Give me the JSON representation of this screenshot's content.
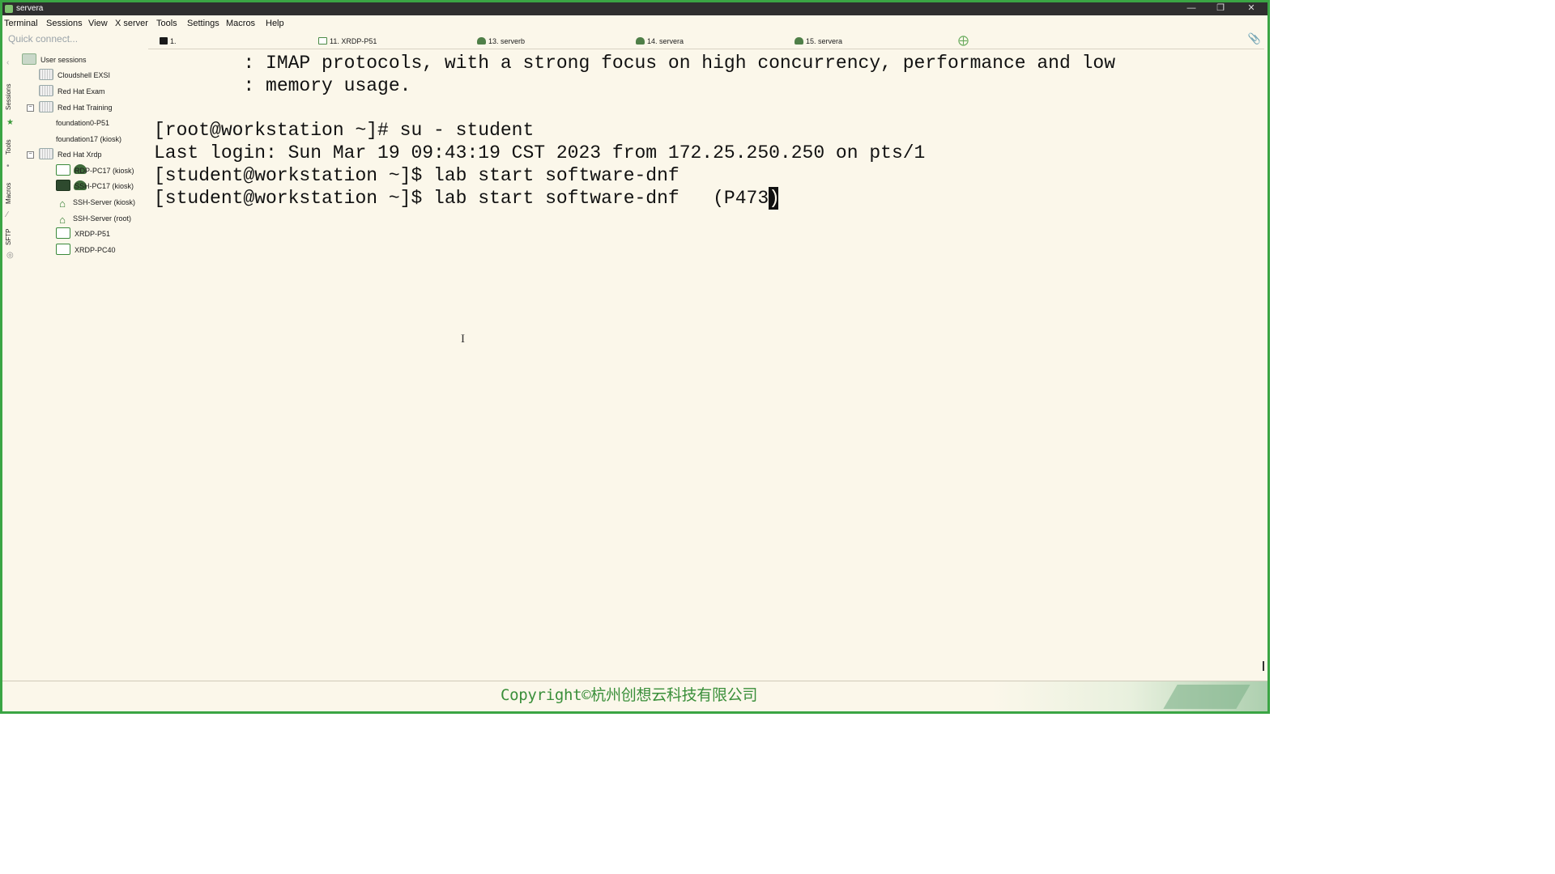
{
  "window": {
    "title": "servera"
  },
  "menu": [
    "Terminal",
    "Sessions",
    "View",
    "X server",
    "Tools",
    "Settings",
    "Macros",
    "Help"
  ],
  "quick_connect": {
    "placeholder": "Quick connect..."
  },
  "tabs": [
    {
      "label": "1.",
      "icon": "terminal-icon"
    },
    {
      "label": "11. XRDP-P51",
      "icon": "screen-icon"
    },
    {
      "label": "13. serverb",
      "icon": "tree-icon"
    },
    {
      "label": "14. servera",
      "icon": "tree-icon"
    },
    {
      "label": "15. servera",
      "icon": "tree-icon"
    }
  ],
  "side_tabs": [
    "Sessions",
    "Tools",
    "Macros",
    "SFTP"
  ],
  "tree": {
    "root": "User sessions",
    "items": [
      "Cloudshell EXSI",
      "Red Hat Exam",
      "Red Hat Training",
      "foundation0-P51",
      "foundation17 (kiosk)",
      "Red Hat Xrdp",
      "RDP-PC17 (kiosk)",
      "SSH-PC17 (kiosk)",
      "SSH-Server (kiosk)",
      "SSH-Server (root)",
      "XRDP-P51",
      "XRDP-PC40"
    ]
  },
  "terminal": {
    "lines": [
      "        : IMAP protocols, with a strong focus on high concurrency, performance and low",
      "        : memory usage.",
      "",
      "[root@workstation ~]# su - student",
      "Last login: Sun Mar 19 09:43:19 CST 2023 from 172.25.250.250 on pts/1",
      "[student@workstation ~]$ lab start software-dnf",
      "[student@workstation ~]$ lab start software-dnf   (P473"
    ],
    "cursor_char": ")"
  },
  "footer": {
    "copyright": "Copyright©杭州创想云科技有限公司"
  },
  "colors": {
    "accent": "#3aa544",
    "terminal_bg": "#fbf7ea",
    "titlebar": "#2f2f2f"
  }
}
